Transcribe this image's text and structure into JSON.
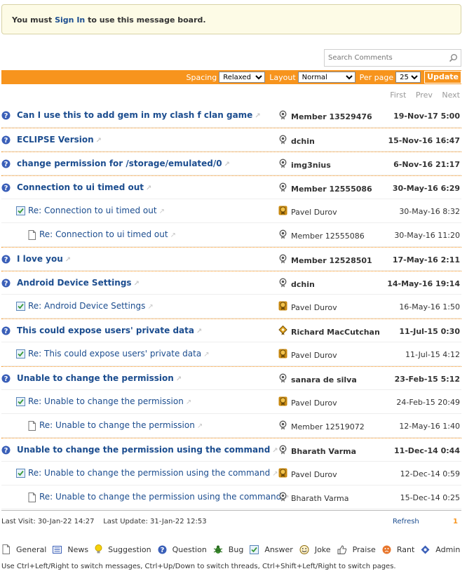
{
  "notice": {
    "prefix": "You must ",
    "link": "Sign In",
    "suffix": " to use this message board."
  },
  "search": {
    "placeholder": "Search Comments"
  },
  "toolbar": {
    "spacing_label": "Spacing",
    "spacing_value": "Relaxed",
    "layout_label": "Layout",
    "layout_value": "Normal",
    "perpage_label": "Per page",
    "perpage_value": "25",
    "update_label": "Update",
    "accent_color": "#f7941d"
  },
  "pager": {
    "first": "First",
    "prev": "Prev",
    "next": "Next"
  },
  "messages": [
    {
      "type": "question",
      "level": 0,
      "subject": "Can I use this to add gem in my clash f clan game",
      "author": "Member 13529476",
      "avatar": "member-icon",
      "date": "19-Nov-17 5:00"
    },
    {
      "type": "question",
      "level": 0,
      "subject": "ECLIPSE Version",
      "author": "dchin",
      "avatar": "member-icon",
      "date": "15-Nov-16 16:47"
    },
    {
      "type": "question",
      "level": 0,
      "subject": "change permission for /storage/emulated/0",
      "author": "img3nius",
      "avatar": "member-icon",
      "date": "6-Nov-16 21:17"
    },
    {
      "type": "question",
      "level": 0,
      "subject": "Connection to ui timed out",
      "author": "Member 12555086",
      "avatar": "member-icon",
      "date": "30-May-16 6:29"
    },
    {
      "type": "answer",
      "level": 1,
      "subject": "Re: Connection to ui timed out",
      "author": "Pavel Durov",
      "avatar": "gold-member-icon",
      "date": "30-May-16 8:32"
    },
    {
      "type": "general",
      "level": 2,
      "subject": "Re: Connection to ui timed out",
      "author": "Member 12555086",
      "avatar": "member-icon",
      "date": "30-May-16 11:20"
    },
    {
      "type": "question",
      "level": 0,
      "subject": "I love you",
      "author": "Member 12528501",
      "avatar": "member-icon",
      "date": "17-May-16 2:11"
    },
    {
      "type": "question",
      "level": 0,
      "subject": "Android Device Settings",
      "author": "dchin",
      "avatar": "member-icon",
      "date": "14-May-16 19:14"
    },
    {
      "type": "answer",
      "level": 1,
      "subject": "Re: Android Device Settings",
      "author": "Pavel Durov",
      "avatar": "gold-member-icon",
      "date": "16-May-16 1:50"
    },
    {
      "type": "question",
      "level": 0,
      "subject": "This could expose users' private data",
      "author": "Richard MacCutchan",
      "avatar": "diamond-member-icon",
      "date": "11-Jul-15 0:30"
    },
    {
      "type": "answer",
      "level": 1,
      "subject": "Re: This could expose users' private data",
      "author": "Pavel Durov",
      "avatar": "gold-member-icon",
      "date": "11-Jul-15 4:12"
    },
    {
      "type": "question",
      "level": 0,
      "subject": "Unable to change the permission",
      "author": "sanara de silva",
      "avatar": "member-icon",
      "date": "23-Feb-15 5:12"
    },
    {
      "type": "answer",
      "level": 1,
      "subject": "Re: Unable to change the permission",
      "author": "Pavel Durov",
      "avatar": "gold-member-icon",
      "date": "24-Feb-15 20:49"
    },
    {
      "type": "general",
      "level": 2,
      "subject": "Re: Unable to change the permission",
      "author": "Member 12519072",
      "avatar": "member-icon",
      "date": "12-May-16 1:40"
    },
    {
      "type": "question",
      "level": 0,
      "subject": "Unable to change the permission using the command",
      "author": "Bharath Varma",
      "avatar": "member-icon",
      "date": "11-Dec-14 0:44"
    },
    {
      "type": "answer",
      "level": 1,
      "subject": "Re: Unable to change the permission using the command",
      "author": "Pavel Durov",
      "avatar": "gold-member-icon",
      "date": "12-Dec-14 0:59"
    },
    {
      "type": "general",
      "level": 2,
      "subject": "Re: Unable to change the permission using the command",
      "author": "Bharath Varma",
      "avatar": "member-icon",
      "date": "15-Dec-14 0:25"
    }
  ],
  "footer": {
    "last_visit": "Last Visit: 30-Jan-22 14:27",
    "last_update": "Last Update: 31-Jan-22 12:53",
    "refresh": "Refresh",
    "page": "1"
  },
  "legend": [
    {
      "icon": "general-icon",
      "label": "General"
    },
    {
      "icon": "news-icon",
      "label": "News"
    },
    {
      "icon": "suggestion-icon",
      "label": "Suggestion"
    },
    {
      "icon": "question-icon",
      "label": "Question"
    },
    {
      "icon": "bug-icon",
      "label": "Bug"
    },
    {
      "icon": "answer-icon",
      "label": "Answer"
    },
    {
      "icon": "joke-icon",
      "label": "Joke"
    },
    {
      "icon": "praise-icon",
      "label": "Praise"
    },
    {
      "icon": "rant-icon",
      "label": "Rant"
    },
    {
      "icon": "admin-icon",
      "label": "Admin"
    }
  ],
  "help": "Use Ctrl+Left/Right to switch messages, Ctrl+Up/Down to switch threads, Ctrl+Shift+Left/Right to switch pages."
}
